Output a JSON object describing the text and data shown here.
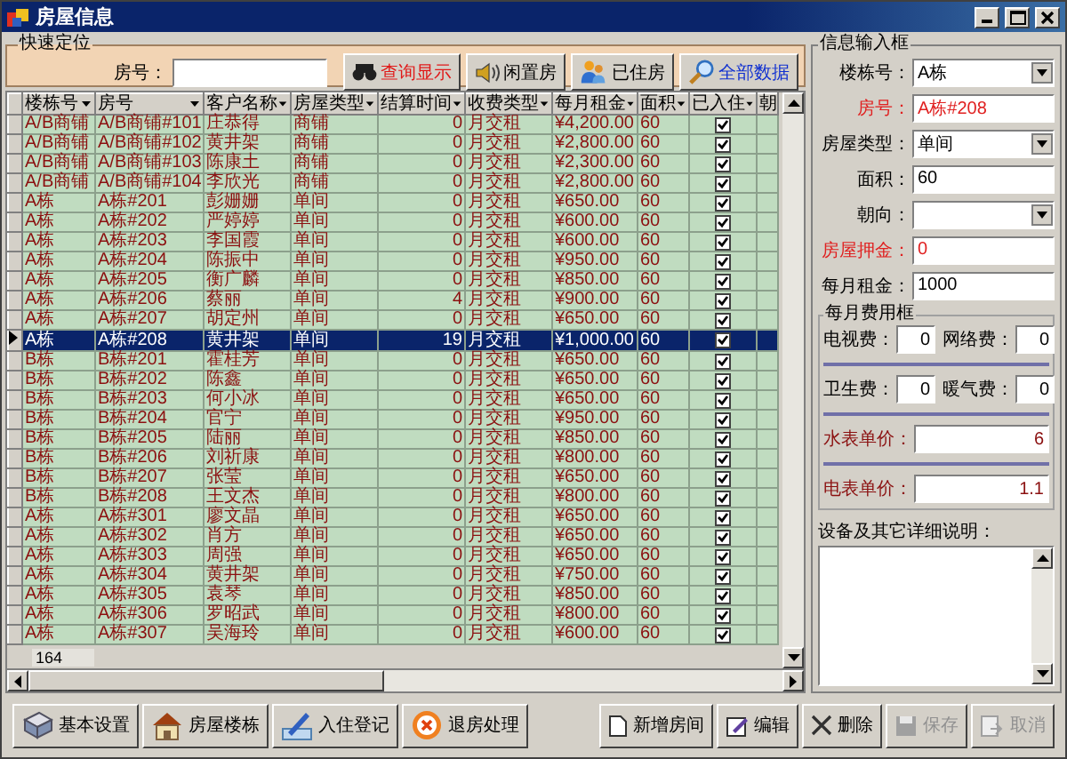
{
  "window": {
    "title": "房屋信息"
  },
  "quick_search": {
    "title": "快速定位",
    "label": "房号：",
    "buttons": [
      {
        "label": "查询显示",
        "color": "#e01818"
      },
      {
        "label": "闲置房",
        "color": "#000000"
      },
      {
        "label": "已住房",
        "color": "#000000"
      },
      {
        "label": "全部数据",
        "color": "#1030d0"
      }
    ]
  },
  "table": {
    "columns": [
      "楼栋号",
      "房号",
      "客户名称",
      "房屋类型",
      "结算时间",
      "收费类型",
      "每月租金",
      "面积",
      "已入住",
      "朝"
    ],
    "rows": [
      {
        "building": "A/B商铺",
        "room": "A/B商铺#101",
        "customer": "庄恭得",
        "type": "商铺",
        "days": "0",
        "fee_type": "月交租",
        "rent": "¥4,200.00",
        "area": "60",
        "occupied": true,
        "selected": false
      },
      {
        "building": "A/B商铺",
        "room": "A/B商铺#102",
        "customer": "黄井架",
        "type": "商铺",
        "days": "0",
        "fee_type": "月交租",
        "rent": "¥2,800.00",
        "area": "60",
        "occupied": true,
        "selected": false
      },
      {
        "building": "A/B商铺",
        "room": "A/B商铺#103",
        "customer": "陈康土",
        "type": "商铺",
        "days": "0",
        "fee_type": "月交租",
        "rent": "¥2,300.00",
        "area": "60",
        "occupied": true,
        "selected": false
      },
      {
        "building": "A/B商铺",
        "room": "A/B商铺#104",
        "customer": "李欣光",
        "type": "商铺",
        "days": "0",
        "fee_type": "月交租",
        "rent": "¥2,800.00",
        "area": "60",
        "occupied": true,
        "selected": false
      },
      {
        "building": "A栋",
        "room": "A栋#201",
        "customer": "彭姗姗",
        "type": "单间",
        "days": "0",
        "fee_type": "月交租",
        "rent": "¥650.00",
        "area": "60",
        "occupied": true,
        "selected": false
      },
      {
        "building": "A栋",
        "room": "A栋#202",
        "customer": "严婷婷",
        "type": "单间",
        "days": "0",
        "fee_type": "月交租",
        "rent": "¥600.00",
        "area": "60",
        "occupied": true,
        "selected": false
      },
      {
        "building": "A栋",
        "room": "A栋#203",
        "customer": "李国霞",
        "type": "单间",
        "days": "0",
        "fee_type": "月交租",
        "rent": "¥600.00",
        "area": "60",
        "occupied": true,
        "selected": false
      },
      {
        "building": "A栋",
        "room": "A栋#204",
        "customer": "陈振中",
        "type": "单间",
        "days": "0",
        "fee_type": "月交租",
        "rent": "¥950.00",
        "area": "60",
        "occupied": true,
        "selected": false
      },
      {
        "building": "A栋",
        "room": "A栋#205",
        "customer": "衡广麟",
        "type": "单间",
        "days": "0",
        "fee_type": "月交租",
        "rent": "¥850.00",
        "area": "60",
        "occupied": true,
        "selected": false
      },
      {
        "building": "A栋",
        "room": "A栋#206",
        "customer": "蔡丽",
        "type": "单间",
        "days": "4",
        "fee_type": "月交租",
        "rent": "¥900.00",
        "area": "60",
        "occupied": true,
        "selected": false
      },
      {
        "building": "A栋",
        "room": "A栋#207",
        "customer": "胡定州",
        "type": "单间",
        "days": "0",
        "fee_type": "月交租",
        "rent": "¥650.00",
        "area": "60",
        "occupied": true,
        "selected": false
      },
      {
        "building": "A栋",
        "room": "A栋#208",
        "customer": "黄井架",
        "type": "单间",
        "days": "19",
        "fee_type": "月交租",
        "rent": "¥1,000.00",
        "area": "60",
        "occupied": true,
        "selected": true
      },
      {
        "building": "B栋",
        "room": "B栋#201",
        "customer": "霍桂芳",
        "type": "单间",
        "days": "0",
        "fee_type": "月交租",
        "rent": "¥650.00",
        "area": "60",
        "occupied": true,
        "selected": false
      },
      {
        "building": "B栋",
        "room": "B栋#202",
        "customer": "陈鑫",
        "type": "单间",
        "days": "0",
        "fee_type": "月交租",
        "rent": "¥650.00",
        "area": "60",
        "occupied": true,
        "selected": false
      },
      {
        "building": "B栋",
        "room": "B栋#203",
        "customer": "何小冰",
        "type": "单间",
        "days": "0",
        "fee_type": "月交租",
        "rent": "¥650.00",
        "area": "60",
        "occupied": true,
        "selected": false
      },
      {
        "building": "B栋",
        "room": "B栋#204",
        "customer": "官宁",
        "type": "单间",
        "days": "0",
        "fee_type": "月交租",
        "rent": "¥950.00",
        "area": "60",
        "occupied": true,
        "selected": false
      },
      {
        "building": "B栋",
        "room": "B栋#205",
        "customer": "陆丽",
        "type": "单间",
        "days": "0",
        "fee_type": "月交租",
        "rent": "¥850.00",
        "area": "60",
        "occupied": true,
        "selected": false
      },
      {
        "building": "B栋",
        "room": "B栋#206",
        "customer": "刘祈康",
        "type": "单间",
        "days": "0",
        "fee_type": "月交租",
        "rent": "¥800.00",
        "area": "60",
        "occupied": true,
        "selected": false
      },
      {
        "building": "B栋",
        "room": "B栋#207",
        "customer": "张莹",
        "type": "单间",
        "days": "0",
        "fee_type": "月交租",
        "rent": "¥650.00",
        "area": "60",
        "occupied": true,
        "selected": false
      },
      {
        "building": "B栋",
        "room": "B栋#208",
        "customer": "王文杰",
        "type": "单间",
        "days": "0",
        "fee_type": "月交租",
        "rent": "¥800.00",
        "area": "60",
        "occupied": true,
        "selected": false
      },
      {
        "building": "A栋",
        "room": "A栋#301",
        "customer": "廖文晶",
        "type": "单间",
        "days": "0",
        "fee_type": "月交租",
        "rent": "¥650.00",
        "area": "60",
        "occupied": true,
        "selected": false
      },
      {
        "building": "A栋",
        "room": "A栋#302",
        "customer": "肖方",
        "type": "单间",
        "days": "0",
        "fee_type": "月交租",
        "rent": "¥650.00",
        "area": "60",
        "occupied": true,
        "selected": false
      },
      {
        "building": "A栋",
        "room": "A栋#303",
        "customer": "周强",
        "type": "单间",
        "days": "0",
        "fee_type": "月交租",
        "rent": "¥650.00",
        "area": "60",
        "occupied": true,
        "selected": false
      },
      {
        "building": "A栋",
        "room": "A栋#304",
        "customer": "黄井架",
        "type": "单间",
        "days": "0",
        "fee_type": "月交租",
        "rent": "¥750.00",
        "area": "60",
        "occupied": true,
        "selected": false
      },
      {
        "building": "A栋",
        "room": "A栋#305",
        "customer": "袁琴",
        "type": "单间",
        "days": "0",
        "fee_type": "月交租",
        "rent": "¥850.00",
        "area": "60",
        "occupied": true,
        "selected": false
      },
      {
        "building": "A栋",
        "room": "A栋#306",
        "customer": "罗昭武",
        "type": "单间",
        "days": "0",
        "fee_type": "月交租",
        "rent": "¥800.00",
        "area": "60",
        "occupied": true,
        "selected": false
      },
      {
        "building": "A栋",
        "room": "A栋#307",
        "customer": "吴海玲",
        "type": "单间",
        "days": "0",
        "fee_type": "月交租",
        "rent": "¥600.00",
        "area": "60",
        "occupied": true,
        "selected": false
      }
    ],
    "record_count": "164"
  },
  "info_panel": {
    "title": "信息输入框",
    "fields": [
      {
        "label": "楼栋号：",
        "kind": "select",
        "value": "A栋",
        "required": false
      },
      {
        "label": "房号：",
        "kind": "input",
        "value": "A栋#208",
        "required": true
      },
      {
        "label": "房屋类型：",
        "kind": "select",
        "value": "单间",
        "required": false
      },
      {
        "label": "面积：",
        "kind": "input",
        "value": "60",
        "required": false
      },
      {
        "label": "朝向：",
        "kind": "select",
        "required": false
      },
      {
        "label": "房屋押金：",
        "kind": "input",
        "value": "0",
        "required": true
      },
      {
        "label": "每月租金：",
        "kind": "input",
        "value": "1000",
        "required": false
      }
    ],
    "fees": {
      "title": "每月费用框",
      "pairs": [
        [
          {
            "label": "电视费：",
            "value": "0"
          },
          {
            "label": "网络费：",
            "value": "0"
          }
        ],
        [
          {
            "label": "卫生费：",
            "value": "0"
          },
          {
            "label": "暖气费：",
            "value": "0"
          }
        ]
      ],
      "rates": [
        {
          "label": "水表单价：",
          "value": "6"
        },
        {
          "label": "电表单价：",
          "value": "1.1"
        }
      ]
    },
    "notes_label": "设备及其它详细说明："
  },
  "toolbar_left": [
    {
      "label": "基本设置",
      "disabled": false
    },
    {
      "label": "房屋楼栋",
      "disabled": false
    },
    {
      "label": "入住登记",
      "disabled": false
    },
    {
      "label": "退房处理",
      "disabled": false
    }
  ],
  "toolbar_right": [
    {
      "label": "新增房间",
      "disabled": false
    },
    {
      "label": "编辑",
      "disabled": false
    },
    {
      "label": "删除",
      "disabled": false
    },
    {
      "label": "保存",
      "disabled": true
    },
    {
      "label": "取消",
      "disabled": true
    }
  ]
}
